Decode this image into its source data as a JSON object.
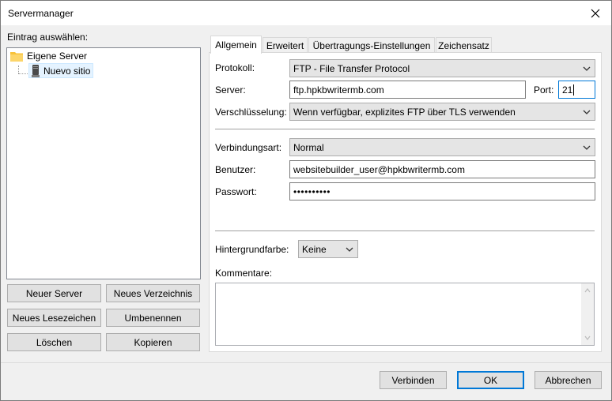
{
  "window": {
    "title": "Servermanager"
  },
  "left": {
    "select_label": "Eintrag auswählen:",
    "tree": {
      "root": "Eigene Server",
      "child": "Nuevo sitio"
    },
    "buttons": {
      "new_server": "Neuer Server",
      "new_folder": "Neues Verzeichnis",
      "new_bookmark": "Neues Lesezeichen",
      "rename": "Umbenennen",
      "delete": "Löschen",
      "copy": "Kopieren"
    }
  },
  "tabs": [
    "Allgemein",
    "Erweitert",
    "Übertragungs-Einstellungen",
    "Zeichensatz"
  ],
  "general": {
    "protocol_label": "Protokoll:",
    "protocol_value": "FTP - File Transfer Protocol",
    "server_label": "Server:",
    "server_value": "ftp.hpkbwritermb.com",
    "port_label": "Port:",
    "port_value": "21",
    "encryption_label": "Verschlüsselung:",
    "encryption_value": "Wenn verfügbar, explizites FTP über TLS verwenden",
    "logon_label": "Verbindungsart:",
    "logon_value": "Normal",
    "user_label": "Benutzer:",
    "user_value": "websitebuilder_user@hpkbwritermb.com",
    "password_label": "Passwort:",
    "password_value": "••••••••••",
    "bgcolor_label": "Hintergrundfarbe:",
    "bgcolor_value": "Keine",
    "comments_label": "Kommentare:"
  },
  "footer": {
    "connect": "Verbinden",
    "ok": "OK",
    "cancel": "Abbrechen"
  },
  "colors": {
    "accent": "#0078d7",
    "selection": "#e5f3ff",
    "folder": "#f8c23a"
  }
}
